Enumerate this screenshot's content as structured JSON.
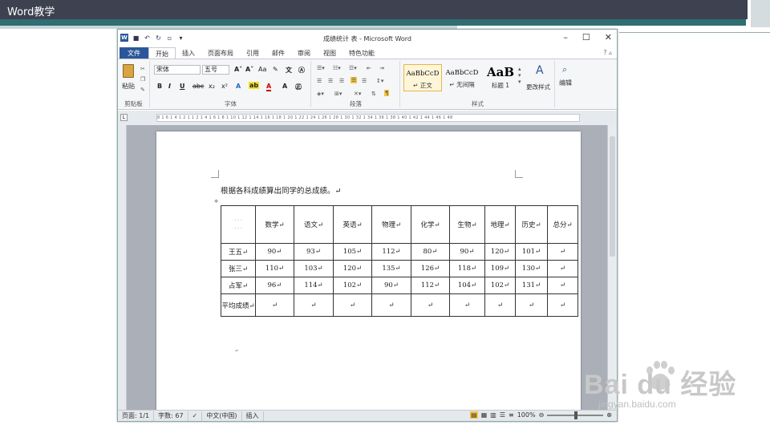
{
  "slide": {
    "title": "Word教学"
  },
  "window": {
    "title": "成绩统计 表 - Microsoft Word",
    "app_icon": "W",
    "controls": {
      "minimize": "–",
      "maximize": "☐",
      "close": "✕"
    }
  },
  "tabs": [
    {
      "label": "文件"
    },
    {
      "label": "开始"
    },
    {
      "label": "插入"
    },
    {
      "label": "页面布局"
    },
    {
      "label": "引用"
    },
    {
      "label": "邮件"
    },
    {
      "label": "审阅"
    },
    {
      "label": "视图"
    },
    {
      "label": "特色功能"
    }
  ],
  "ribbon": {
    "clipboard": {
      "paste_label": "粘贴",
      "group_label": "剪贴板"
    },
    "font": {
      "font_name": "宋体",
      "font_size": "五号",
      "group_label": "字体",
      "bold": "B",
      "italic": "I",
      "underline": "U",
      "strike": "abc",
      "sub": "x₂",
      "sup": "x²"
    },
    "paragraph": {
      "group_label": "段落"
    },
    "styles": {
      "items": [
        {
          "sample": "AaBbCcD",
          "name": "↵ 正文"
        },
        {
          "sample": "AaBbCcD",
          "name": "↵ 无间隔"
        },
        {
          "sample": "AaB",
          "name": "标题 1"
        }
      ],
      "change_label": "更改样式",
      "group_label": "样式"
    },
    "editing": {
      "label": "编辑"
    }
  },
  "ruler": {
    "ticks": "8 1 6 1 4 1 2 1 1 2 1 4 1 6 1 8 1 10 1 12 1 14 1 16 1 18 1 20 1 22 1 24 1 26 1 28 1 30 1 32 1 34 1 36 1 38 1 40 1 42 1 44 1 46 1 48"
  },
  "document": {
    "paragraph": "根据各科成绩算出同学的总成绩。↵",
    "table": {
      "headers": [
        "",
        "数学↵",
        "语文↵",
        "英语↵",
        "物理↵",
        "化学↵",
        "生物↵",
        "地理↵",
        "历史↵",
        "总分↵"
      ],
      "rows": [
        [
          "王五↵",
          "90↵",
          "93↵",
          "105↵",
          "112↵",
          "80↵",
          "90↵",
          "120↵",
          "101↵",
          "↵"
        ],
        [
          "张三↵",
          "110↵",
          "103↵",
          "120↵",
          "135↵",
          "126↵",
          "118↵",
          "109↵",
          "130↵",
          "↵"
        ],
        [
          "占军↵",
          "96↵",
          "114↵",
          "102↵",
          "90↵",
          "112↵",
          "104↵",
          "102↵",
          "131↵",
          "↵"
        ],
        [
          "平均成绩↵",
          "↵",
          "↵",
          "↵",
          "↵",
          "↵",
          "↵",
          "↵",
          "↵",
          "↵"
        ]
      ]
    },
    "after_table": "↵"
  },
  "statusbar": {
    "page": "页面: 1/1",
    "words": "字数: 67",
    "language": "中文(中国)",
    "insert": "插入",
    "zoom": "100%"
  },
  "watermark": {
    "main": "Bai du 经验",
    "sub": "jingyan.baidu.com"
  },
  "colors": {
    "slide_dark": "#3e4150",
    "slide_teal": "#2f6e73",
    "word_blue": "#2b579a"
  }
}
